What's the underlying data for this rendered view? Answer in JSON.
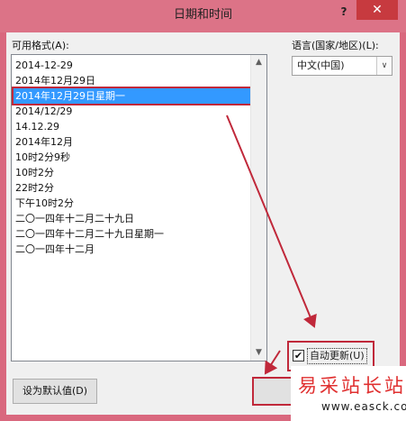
{
  "window": {
    "title": "日期和时间",
    "help_label": "?",
    "close_label": "✕"
  },
  "formats": {
    "label": "可用格式(A):",
    "selected_index": 2,
    "items": [
      "2014-12-29",
      "2014年12月29日",
      "2014年12月29日星期一",
      "2014/12/29",
      "14.12.29",
      "2014年12月",
      "10时2分9秒",
      "10时2分",
      "22时2分",
      "下午10时2分",
      "二〇一四年十二月二十九日",
      "二〇一四年十二月二十九日星期一",
      "二〇一四年十二月"
    ]
  },
  "language": {
    "label": "语言(国家/地区)(L):",
    "value": "中文(中国)"
  },
  "auto_update": {
    "label": "自动更新(U)",
    "checked": true,
    "check_glyph": "✔"
  },
  "buttons": {
    "set_default": "设为默认值(D)",
    "ok": ""
  },
  "icons": {
    "scroll_up": "▲",
    "scroll_down": "▼",
    "dropdown": "∨"
  },
  "watermark": {
    "text_cn": "易采站长站",
    "url": "www.easck.com"
  },
  "colors": {
    "selection": "#3399ff",
    "annotation": "#c0283a",
    "title_bar": "#dc7387"
  }
}
